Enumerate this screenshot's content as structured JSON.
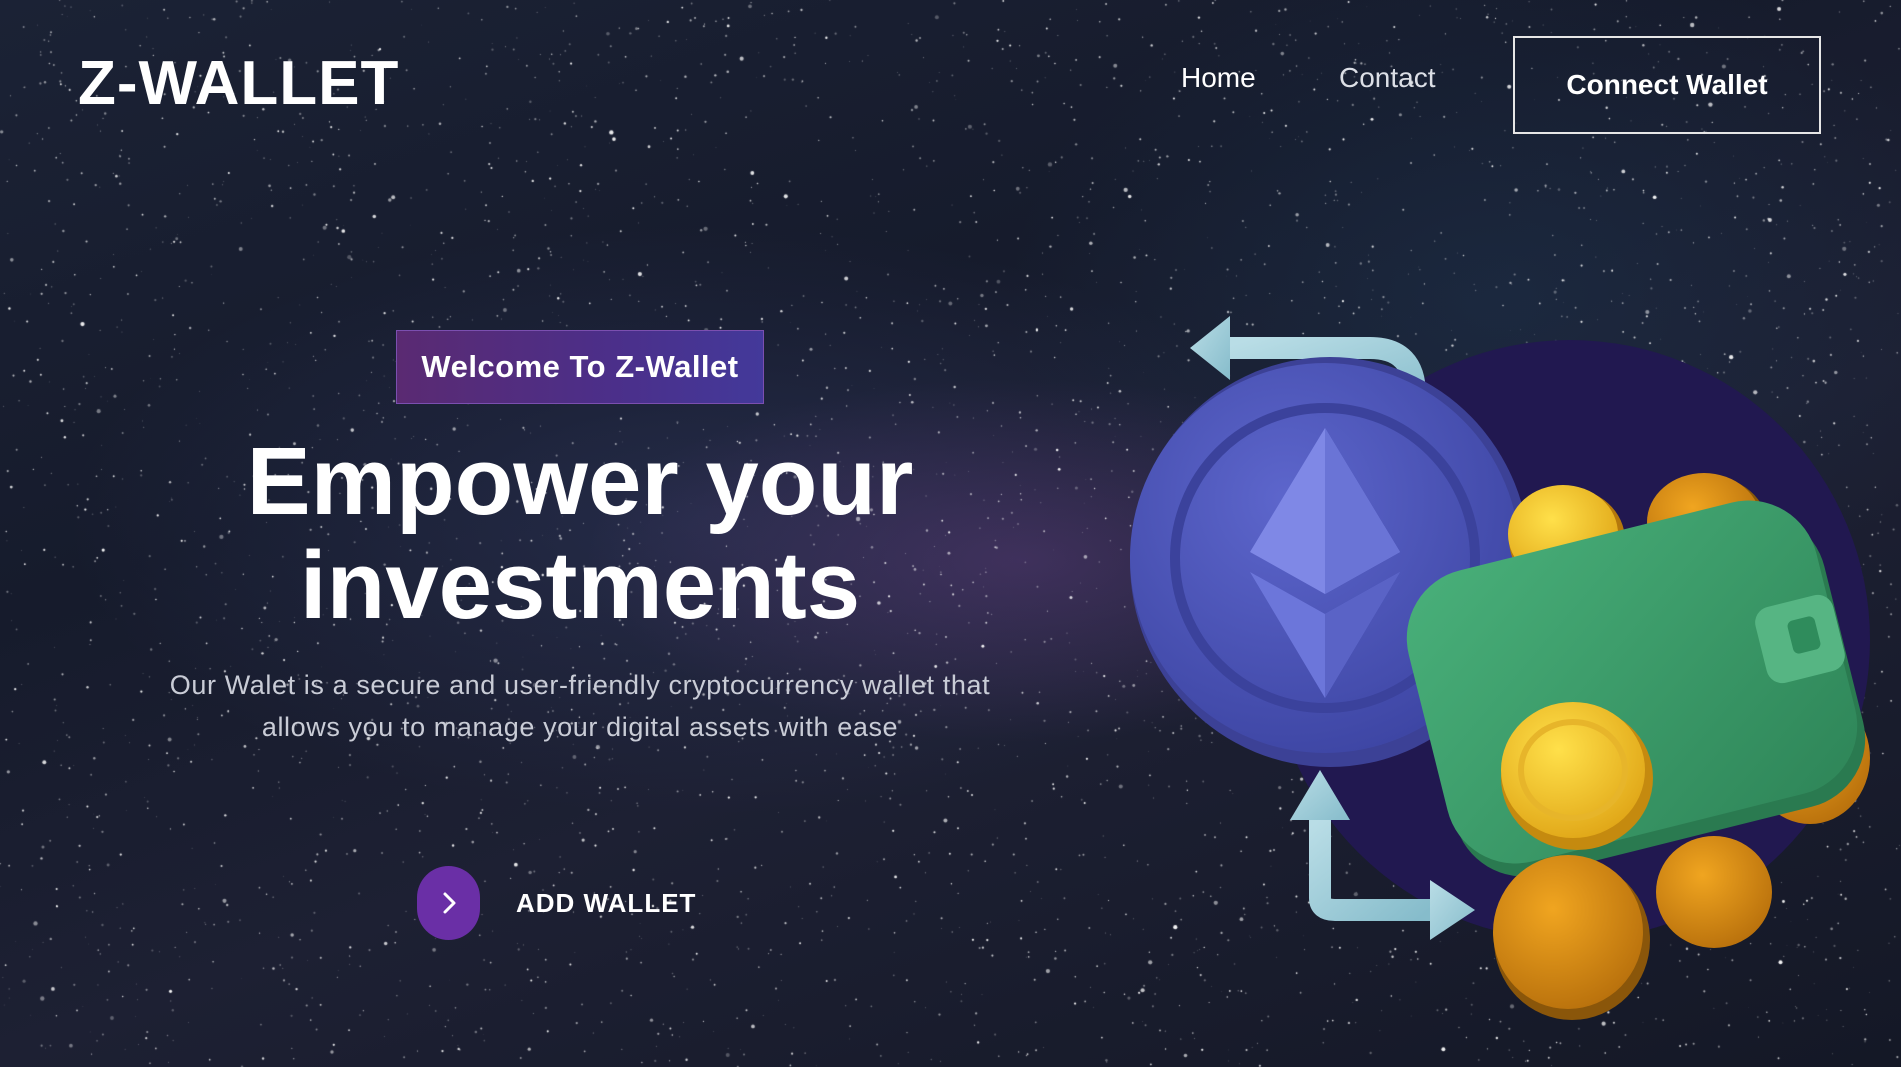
{
  "header": {
    "logo": "Z-WALLET",
    "nav": {
      "home": "Home",
      "contact": "Contact"
    },
    "connect_wallet": "Connect Wallet"
  },
  "hero": {
    "badge": "Welcome To Z-Wallet",
    "headline_line1": "Empower your",
    "headline_line2": "investments",
    "description_line1": "Our Walet is a secure and user-friendly cryptocurrency wallet that",
    "description_line2": "allows you to manage your digital assets with ease",
    "cta_label": "ADD WALLET",
    "cta_icon": "chevron-right-icon"
  },
  "illustration": {
    "icons": [
      "ethereum-coin-icon",
      "wallet-icon",
      "exchange-arrows-icon",
      "gold-coin-icon"
    ]
  },
  "colors": {
    "accent_purple": "#6a2fa6",
    "badge_gradient_start": "#5a2a72",
    "badge_gradient_end": "#43399a",
    "ethereum_blue": "#4e56b8",
    "wallet_green": "#3b9a6a",
    "coin_gold": "#e0a21a",
    "backdrop_circle": "#211850"
  }
}
